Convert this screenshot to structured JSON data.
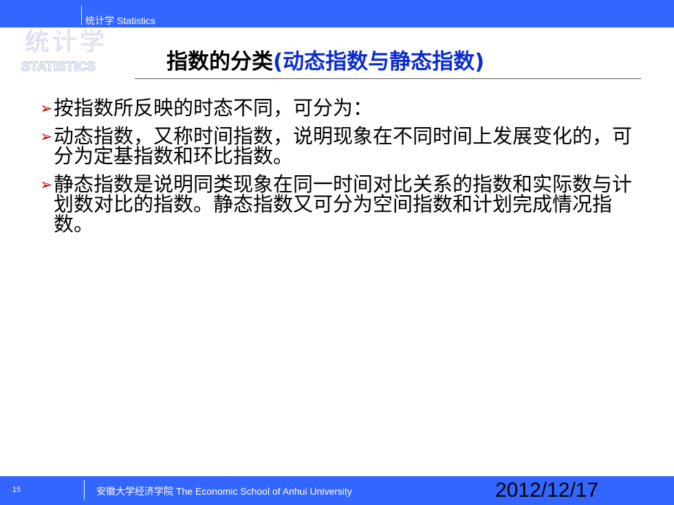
{
  "header": {
    "label": "统计学  Statistics",
    "logo_cn": "统计学",
    "logo_en": "STATISTICS"
  },
  "slide": {
    "title_black": "指数的分类",
    "title_blue": "(动态指数与静态指数)",
    "bullets": [
      "按指数所反映的时态不同，可分为：",
      "动态指数，又称时间指数，说明现象在不同时间上发展变化的，可分为定基指数和环比指数。",
      "静态指数是说明同类现象在同一时间对比关系的指数和实际数与计划数对比的指数。静态指数又可分为空间指数和计划完成情况指数。"
    ],
    "bullet_icon": "arrow-bullet-icon"
  },
  "footer": {
    "page_number": "15",
    "school": "安徽大学经济学院 The Economic School of Anhui University",
    "date": "2012/12/17"
  },
  "colors": {
    "bar": "#3366ff",
    "title_accent": "#0a2bd0",
    "bullet_arrow": "#cc0000"
  }
}
